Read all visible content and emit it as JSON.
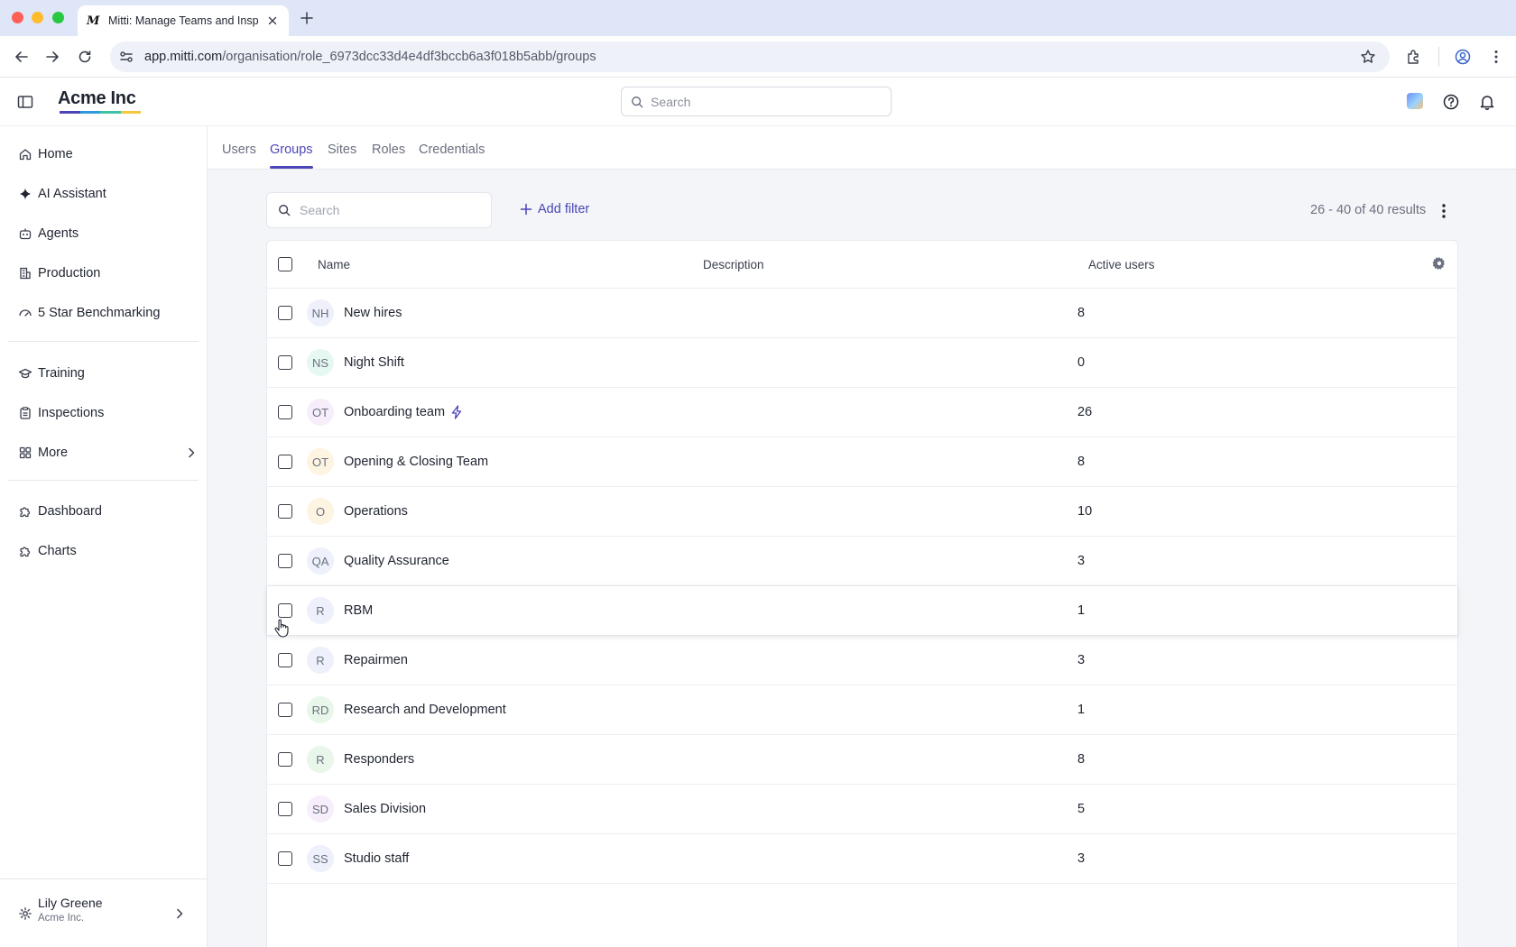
{
  "browser": {
    "tab_title": "Mitti: Manage Teams and Insp",
    "favicon_letter": "M",
    "url_host": "app.mitti.com",
    "url_path": "/organisation/role_6973dcc33d4e4df3bccb6a3f018b5abb/groups"
  },
  "header": {
    "brand": "Acme Inc",
    "brand_colors": [
      "#4b45b8",
      "#2f9bdc",
      "#3cc3a4",
      "#f3c63b"
    ],
    "search_placeholder": "Search"
  },
  "sidebar": {
    "items": [
      {
        "label": "Home",
        "icon": "home-icon"
      },
      {
        "label": "AI Assistant",
        "icon": "sparkle-icon"
      },
      {
        "label": "Agents",
        "icon": "robot-icon"
      },
      {
        "label": "Production",
        "icon": "building-icon"
      },
      {
        "label": "5 Star Benchmarking",
        "icon": "gauge-icon"
      },
      {
        "label": "Training",
        "icon": "graduation-cap-icon"
      },
      {
        "label": "Inspections",
        "icon": "clipboard-icon"
      },
      {
        "label": "More",
        "icon": "grid-icon"
      },
      {
        "label": "Dashboard",
        "icon": "puzzle-icon"
      },
      {
        "label": "Charts",
        "icon": "puzzle-icon"
      }
    ],
    "user": {
      "name": "Lily Greene",
      "org": "Acme Inc."
    }
  },
  "main": {
    "tabs": [
      {
        "label": "Users"
      },
      {
        "label": "Groups"
      },
      {
        "label": "Sites"
      },
      {
        "label": "Roles"
      },
      {
        "label": "Credentials"
      }
    ],
    "active_tab": "Groups",
    "search_placeholder": "Search",
    "add_filter": "Add filter",
    "results": "26 - 40 of 40 results",
    "columns": {
      "name": "Name",
      "description": "Description",
      "active_users": "Active users"
    },
    "rows": [
      {
        "initials": "NH",
        "name": "New hires",
        "description": "",
        "active_users": "8",
        "avatar_bg": "#eef0fb",
        "bolt": false
      },
      {
        "initials": "NS",
        "name": "Night Shift",
        "description": "",
        "active_users": "0",
        "avatar_bg": "#e6f8f2",
        "bolt": false
      },
      {
        "initials": "OT",
        "name": "Onboarding team",
        "description": "",
        "active_users": "26",
        "avatar_bg": "#f6eefb",
        "bolt": true
      },
      {
        "initials": "OT",
        "name": "Opening & Closing Team",
        "description": "",
        "active_users": "8",
        "avatar_bg": "#fdf4e2",
        "bolt": false
      },
      {
        "initials": "O",
        "name": "Operations",
        "description": "",
        "active_users": "10",
        "avatar_bg": "#fdf4e2",
        "bolt": false
      },
      {
        "initials": "QA",
        "name": "Quality Assurance",
        "description": "",
        "active_users": "3",
        "avatar_bg": "#eef0fb",
        "bolt": false
      },
      {
        "initials": "R",
        "name": "RBM",
        "description": "",
        "active_users": "1",
        "avatar_bg": "#eef0fb",
        "bolt": false
      },
      {
        "initials": "R",
        "name": "Repairmen",
        "description": "",
        "active_users": "3",
        "avatar_bg": "#eef0fb",
        "bolt": false
      },
      {
        "initials": "RD",
        "name": "Research and Development",
        "description": "",
        "active_users": "1",
        "avatar_bg": "#e8f7ea",
        "bolt": false
      },
      {
        "initials": "R",
        "name": "Responders",
        "description": "",
        "active_users": "8",
        "avatar_bg": "#e8f7ea",
        "bolt": false
      },
      {
        "initials": "SD",
        "name": "Sales Division",
        "description": "",
        "active_users": "5",
        "avatar_bg": "#f6eefb",
        "bolt": false
      },
      {
        "initials": "SS",
        "name": "Studio staff",
        "description": "",
        "active_users": "3",
        "avatar_bg": "#eef0fb",
        "bolt": false
      }
    ]
  }
}
